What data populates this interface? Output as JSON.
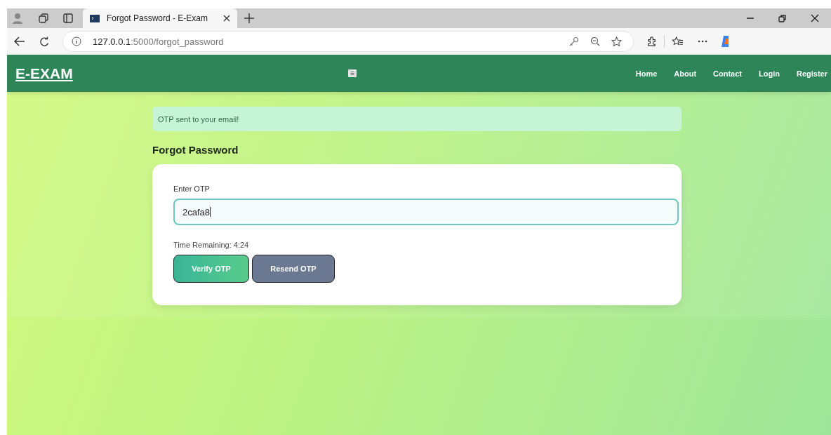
{
  "browser": {
    "tab_title": "Forgot Password - E-Exam",
    "url_host": "127.0.0.1",
    "url_rest": ":5000/forgot_password"
  },
  "navbar": {
    "brand": "E-EXAM",
    "links": [
      {
        "label": "Home"
      },
      {
        "label": "About"
      },
      {
        "label": "Contact"
      },
      {
        "label": "Login"
      },
      {
        "label": "Register"
      }
    ]
  },
  "alert": "OTP sent to your email!",
  "heading": "Forgot Password",
  "form": {
    "label": "Enter OTP",
    "value": "2cafa8",
    "timer": "Time Remaining: 4:24",
    "buttons": [
      {
        "label": "Verify OTP",
        "kind": "primary"
      },
      {
        "label": "Resend OTP",
        "kind": "secondary"
      }
    ]
  }
}
